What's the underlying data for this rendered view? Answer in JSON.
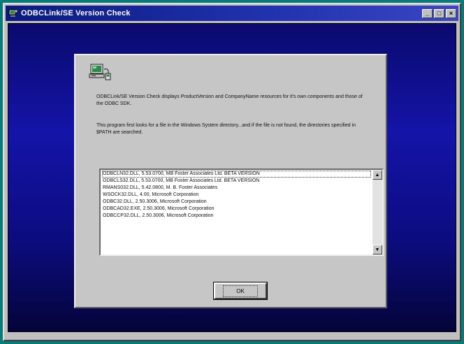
{
  "window": {
    "title": "ODBCLink/SE Version Check",
    "buttons": {
      "minimize": "_",
      "maximize": "□",
      "close": "×"
    },
    "icon": "app-icon"
  },
  "dialog": {
    "icon": "pc-network-icon",
    "description_1": "ODBCLink/SE Version Check displays ProductVersion and CompanyName resources for it's own components and those of the ODBC SDK.",
    "description_2": "This program first looks for a file in the Windows System directory...and if the file is not found, the directories specified in $PATH are searched.",
    "list_items": [
      "ODBCLN32.DLL,  5.53.0700, MB Foster Associates Ltd.     BETA VERSION",
      "ODBCLS32.DLL,  5.53.0700, MB Foster Associates Ltd.     BETA VERSION",
      "RMANS032.DLL,  5.42.0800, M. B. Foster Associates",
      "WSOCK32.DLL,  4.00, Microsoft Corporation",
      "ODBC32.DLL,  2.50.3006, Microsoft Corporation",
      "ODBCAD32.EXE,  2.50.3006, Microsoft Corporation",
      "ODBCCP32.DLL,  2.50.3006, Microsoft Corporation"
    ],
    "scroll_up": "▲",
    "scroll_down": "▼",
    "ok_label": "OK"
  }
}
